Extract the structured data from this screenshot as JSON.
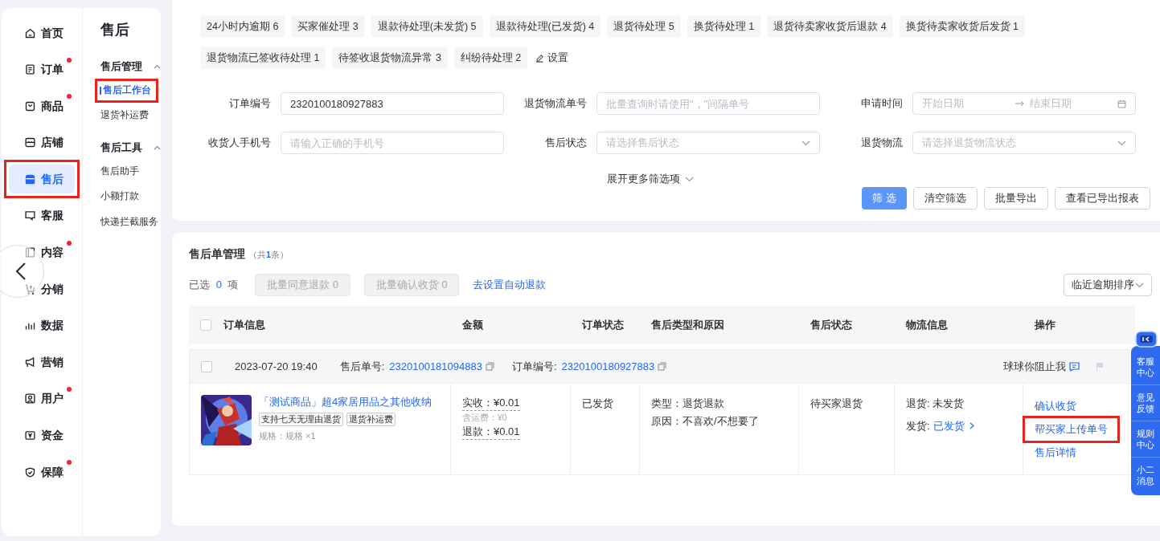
{
  "sidebar": {
    "items": [
      {
        "label": "首页",
        "badge": false,
        "selected": false,
        "highlighted": false
      },
      {
        "label": "订单",
        "badge": true,
        "selected": false,
        "highlighted": false
      },
      {
        "label": "商品",
        "badge": true,
        "selected": false,
        "highlighted": false
      },
      {
        "label": "店铺",
        "badge": false,
        "selected": false,
        "highlighted": false
      },
      {
        "label": "售后",
        "badge": false,
        "selected": true,
        "highlighted": true
      },
      {
        "label": "客服",
        "badge": false,
        "selected": false,
        "highlighted": false
      },
      {
        "label": "内容",
        "badge": true,
        "selected": false,
        "highlighted": false
      },
      {
        "label": "分销",
        "badge": false,
        "selected": false,
        "highlighted": false
      },
      {
        "label": "数据",
        "badge": false,
        "selected": false,
        "highlighted": false
      },
      {
        "label": "营销",
        "badge": false,
        "selected": false,
        "highlighted": false
      },
      {
        "label": "用户",
        "badge": true,
        "selected": false,
        "highlighted": false
      },
      {
        "label": "资金",
        "badge": false,
        "selected": false,
        "highlighted": false
      },
      {
        "label": "保障",
        "badge": true,
        "selected": false,
        "highlighted": false
      }
    ]
  },
  "submenu": {
    "title": "售后",
    "groups": [
      {
        "title": "售后管理",
        "expanded": true,
        "items": [
          {
            "label": "售后工作台",
            "selected": true,
            "highlighted": true
          },
          {
            "label": "退货补运费",
            "selected": false,
            "highlighted": false
          }
        ]
      },
      {
        "title": "售后工具",
        "expanded": true,
        "items": [
          {
            "label": "售后助手",
            "selected": false,
            "highlighted": false
          },
          {
            "label": "小额打款",
            "selected": false,
            "highlighted": false
          },
          {
            "label": "快递拦截服务",
            "selected": false,
            "highlighted": false
          }
        ]
      }
    ]
  },
  "quick_filters": [
    "24小时内逾期 6",
    "买家催处理 3",
    "退款待处理(未发货) 5",
    "退款待处理(已发货) 4",
    "退货待处理 5",
    "换货待处理 1",
    "退货待卖家收货后退款 4",
    "换货待卖家收货后发货 1",
    "退货物流已签收待处理 1",
    "待签收退货物流异常 3",
    "纠纷待处理 2"
  ],
  "settings_link": "设置",
  "filters": [
    {
      "label": "订单编号",
      "kind": "text",
      "value": "2320100180927883"
    },
    {
      "label": "退货物流单号",
      "kind": "text",
      "placeholder": "批量查询时请使用\"，\"间隔单号"
    },
    {
      "label": "申请时间",
      "kind": "daterange",
      "start_placeholder": "开始日期",
      "end_placeholder": "结束日期"
    },
    {
      "label": "收货人手机号",
      "kind": "text",
      "placeholder": "请输入正确的手机号"
    },
    {
      "label": "售后状态",
      "kind": "select",
      "placeholder": "请选择售后状态"
    },
    {
      "label": "退货物流",
      "kind": "select",
      "placeholder": "请选择退货物流状态"
    }
  ],
  "expand_link": "展开更多筛选项",
  "filter_buttons": [
    {
      "label": "筛 选",
      "primary": true
    },
    {
      "label": "清空筛选",
      "primary": false
    },
    {
      "label": "批量导出",
      "primary": false
    },
    {
      "label": "查看已导出报表",
      "primary": false
    }
  ],
  "list": {
    "title": "售后单管理",
    "count_prefix": "（共",
    "count": "1",
    "count_suffix": "条）",
    "selected_label": "已选",
    "selected_count": "0",
    "selected_unit": "项",
    "bulk_buttons": [
      {
        "label": "批量同意退款 0",
        "disabled": true
      },
      {
        "label": "批量确认收货 0",
        "disabled": true
      }
    ],
    "auto_refund_link": "去设置自动退款",
    "sort": "临近逾期排序"
  },
  "table": {
    "all_checked": false,
    "columns": [
      "订单信息",
      "金额",
      "订单状态",
      "售后类型和原因",
      "售后状态",
      "物流信息",
      "操作"
    ],
    "rows": [
      {
        "checked": false,
        "date": "2023-07-20 19:40",
        "aftersale_no_label": "售后单号:",
        "aftersale_no": "2320100181094883",
        "order_no_label": "订单编号:",
        "order_no": "2320100180927883",
        "buyer": "球球你阻止我",
        "product_title": "「测试商品」超4家居用品之其他收纳",
        "tags": [
          "支持七天无理由退货",
          "退货补运费"
        ],
        "spec": "规格：规格 ×1",
        "paid_label": "实收：",
        "paid": "¥0.01",
        "shipping_label": "含运费：",
        "shipping": "¥0",
        "refund_label": "退款：",
        "refund": "¥0.01",
        "order_status": "已发货",
        "type": "类型：退货退款",
        "reason": "原因：不喜欢/不想要了",
        "aftersale_status": "待买家退货",
        "return_logistics": "退货: 未发货",
        "ship_label": "发货:",
        "ship_link": "已发货",
        "actions": [
          {
            "label": "确认收货",
            "highlighted": false
          },
          {
            "label": "帮买家上传单号",
            "highlighted": true
          },
          {
            "label": "售后详情",
            "highlighted": false
          }
        ]
      }
    ]
  },
  "side_panel": [
    "客服中心",
    "意见反馈",
    "规则中心",
    "小二消息"
  ]
}
